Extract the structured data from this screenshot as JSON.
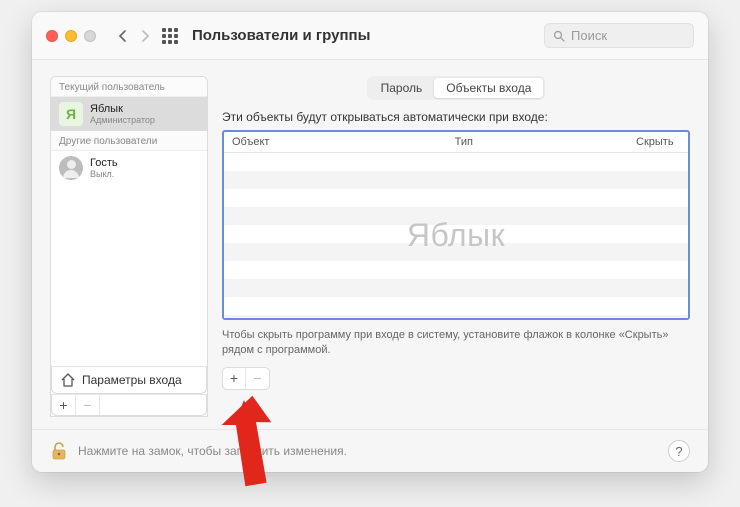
{
  "window": {
    "title": "Пользователи и группы"
  },
  "search": {
    "placeholder": "Поиск"
  },
  "sidebar": {
    "current_user_header": "Текущий пользователь",
    "other_users_header": "Другие пользователи",
    "users": [
      {
        "name": "Яблык",
        "role": "Администратор",
        "initial": "Я"
      },
      {
        "name": "Гость",
        "role": "Выкл."
      }
    ],
    "login_options_label": "Параметры входа"
  },
  "main": {
    "tabs": {
      "password": "Пароль",
      "login_items": "Объекты входа"
    },
    "description": "Эти объекты будут открываться автоматически при входе:",
    "columns": {
      "object": "Объект",
      "type": "Тип",
      "hide": "Скрыть"
    },
    "watermark": "Яблык",
    "hint": "Чтобы скрыть программу при входе в систему, установите флажок в колонке «Скрыть» рядом с программой."
  },
  "footer": {
    "lock_text": "Нажмите на замок, чтобы запретить изменения.",
    "help": "?"
  },
  "glyphs": {
    "plus": "+",
    "minus": "−"
  }
}
